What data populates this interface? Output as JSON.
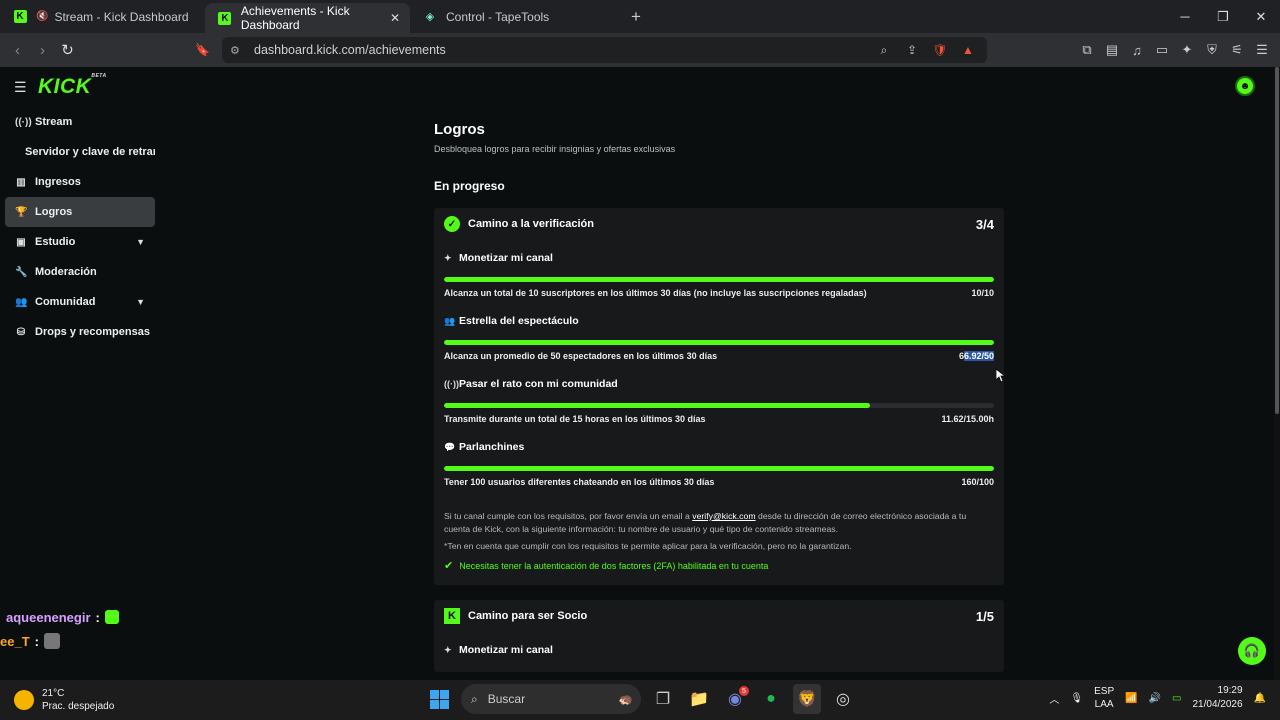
{
  "browser": {
    "tabs": [
      {
        "label": "Stream - Kick Dashboard",
        "muted": true
      },
      {
        "label": "Achievements - Kick Dashboard",
        "active": true
      },
      {
        "label": "Control - TapeTools"
      }
    ],
    "url": "dashboard.kick.com/achievements"
  },
  "header": {
    "logo": "KICK",
    "logo_badge": "BETA"
  },
  "sidebar": {
    "items": [
      {
        "label": "Stream",
        "icon": "broadcast-icon"
      },
      {
        "label": "Servidor y clave de retransn",
        "sub": true
      },
      {
        "label": "Ingresos",
        "icon": "chart-icon"
      },
      {
        "label": "Logros",
        "icon": "trophy-icon",
        "active": true
      },
      {
        "label": "Estudio",
        "icon": "studio-icon",
        "expandable": true
      },
      {
        "label": "Moderación",
        "icon": "wrench-icon"
      },
      {
        "label": "Comunidad",
        "icon": "people-icon",
        "expandable": true
      },
      {
        "label": "Drops y recompensas",
        "icon": "gift-icon"
      }
    ]
  },
  "chat": {
    "lines": [
      {
        "user": "aqueenenegir",
        "color": "#d7a0ff"
      },
      {
        "user": "ee_T",
        "color": "#f5a623"
      }
    ]
  },
  "main": {
    "title": "Logros",
    "subtitle": "Desbloquea logros para recibir insignias y ofertas exclusivas",
    "section": "En progreso",
    "cards": [
      {
        "title": "Camino a la verificación",
        "count": "3/4",
        "achievements": [
          {
            "title": "Monetizar mi canal",
            "desc": "Alcanza un total de 10 suscriptores en los últimos 30 días (no incluye las suscripciones regaladas)",
            "value": "10/10",
            "progress": 1.0
          },
          {
            "title": "Estrella del espectáculo",
            "desc": "Alcanza un promedio de 50 espectadores en los últimos 30 días",
            "value_a": "6",
            "value_b": "6.92/50",
            "progress": 1.0
          },
          {
            "title": "Pasar el rato con mi comunidad",
            "desc": "Transmite durante un total de 15 horas en los últimos 30 días",
            "value": "11.62/15.00h",
            "progress": 0.7747
          },
          {
            "title": "Parlanchines",
            "desc": "Tener 100 usuarios diferentes chateando en los últimos 30 días",
            "value": "160/100",
            "progress": 1.0
          }
        ],
        "notes": {
          "line1_a": "Si tu canal cumple con los requisitos, por favor envía un email a ",
          "email": "verify@kick.com",
          "line1_b": " desde tu dirección de correo electrónico asociada a tu cuenta de Kick, con la siguiente información: tu nombre de usuario y qué tipo de contenido streameas.",
          "line2": "*Ten en cuenta que cumplir con los requisitos te permite aplicar para la verificación, pero no la garantizan.",
          "twofa": "Necesitas tener la autenticación de dos factores (2FA) habilitada en tu cuenta"
        }
      },
      {
        "title": "Camino para ser Socio",
        "count": "1/5",
        "first_achievement": "Monetizar mi canal"
      }
    ]
  },
  "taskbar": {
    "temp": "21°C",
    "weather": "Prac. despejado",
    "search": "Buscar",
    "lang1": "ESP",
    "lang2": "LAA",
    "time": "19:29",
    "date": "21/04/2026",
    "discord_badge": "5"
  },
  "colors": {
    "accent": "#53fc18",
    "bg": "#0b0e0f",
    "card": "#17191b"
  }
}
